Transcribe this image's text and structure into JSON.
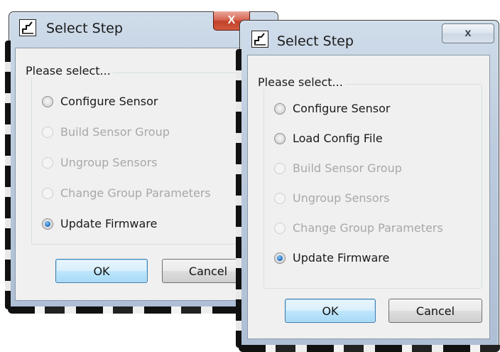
{
  "colors": {
    "radio_selected": "#2a78c9",
    "disabled_text": "#a8a8a8",
    "close_red": "#c2412a"
  },
  "back_dialog": {
    "title": "Select Step",
    "close_label": "X",
    "group_label": "Please select...",
    "options": [
      {
        "label": "Configure Sensor",
        "enabled": true,
        "selected": false
      },
      {
        "label": "Build Sensor Group",
        "enabled": false,
        "selected": false
      },
      {
        "label": "Ungroup Sensors",
        "enabled": false,
        "selected": false
      },
      {
        "label": "Change Group Parameters",
        "enabled": false,
        "selected": false
      },
      {
        "label": "Update Firmware",
        "enabled": true,
        "selected": true
      }
    ],
    "ok_label": "OK",
    "cancel_label": "Cancel"
  },
  "front_dialog": {
    "title": "Select Step",
    "close_label": "x",
    "group_label": "Please select...",
    "options": [
      {
        "label": "Configure Sensor",
        "enabled": true,
        "selected": false
      },
      {
        "label": "Load Config File",
        "enabled": true,
        "selected": false
      },
      {
        "label": "Build Sensor Group",
        "enabled": false,
        "selected": false
      },
      {
        "label": "Ungroup Sensors",
        "enabled": false,
        "selected": false
      },
      {
        "label": "Change Group Parameters",
        "enabled": false,
        "selected": false
      },
      {
        "label": "Update Firmware",
        "enabled": true,
        "selected": true
      }
    ],
    "ok_label": "OK",
    "cancel_label": "Cancel"
  }
}
